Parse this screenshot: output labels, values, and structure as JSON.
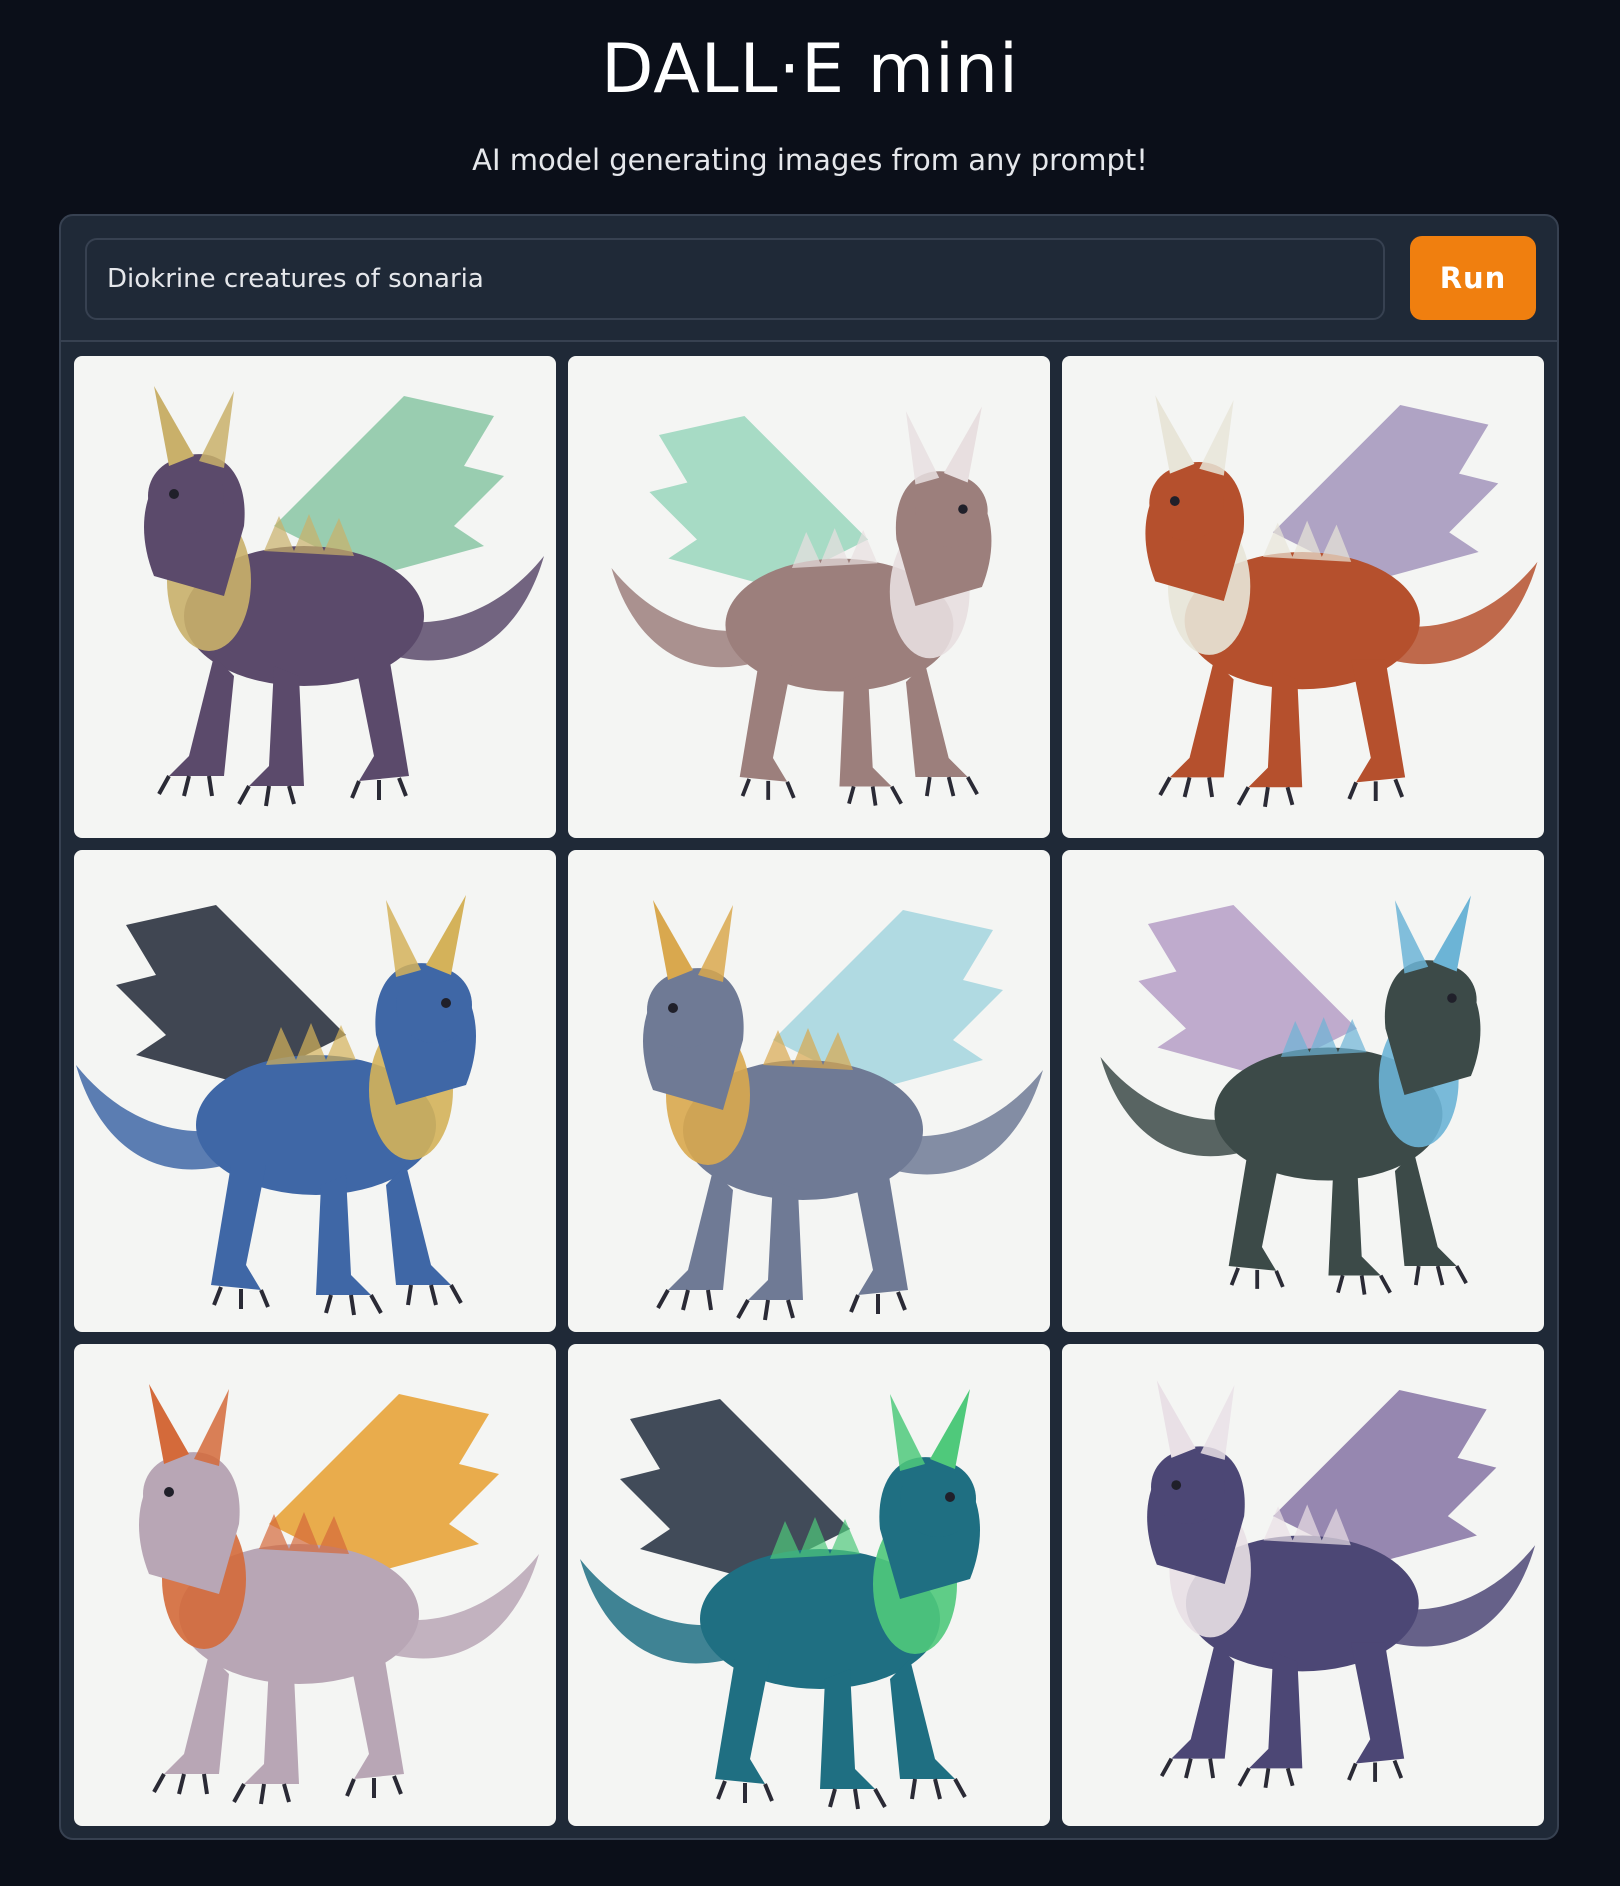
{
  "header": {
    "title": "DALL·E mini",
    "subtitle": "AI model generating images from any prompt!"
  },
  "prompt": {
    "value": "Diokrine creatures of sonaria"
  },
  "run_button": {
    "label": "Run"
  },
  "colors": {
    "background": "#0b0f19",
    "panel": "#1f2937",
    "border": "#374151",
    "accent": "#f07f0f",
    "image_background": "#f4f5f3"
  },
  "gallery": {
    "images": [
      {
        "subject": "purple-winged-creature",
        "body": "#5b4a6b",
        "accent": "#c9b06a",
        "wing": "#8fc9a8"
      },
      {
        "subject": "furred-mint-winged-creature",
        "body": "#9c7f7c",
        "accent": "#e8dfe0",
        "wing": "#9fd8c0"
      },
      {
        "subject": "red-horned-creature",
        "body": "#b5502d",
        "accent": "#e8e5d8",
        "wing": "#a79abf"
      },
      {
        "subject": "blue-spiked-creature",
        "body": "#3f67a6",
        "accent": "#d4b25a",
        "wing": "#2c3340"
      },
      {
        "subject": "grey-spiked-creature",
        "body": "#6f7a95",
        "accent": "#d9a84e",
        "wing": "#a9d7e0"
      },
      {
        "subject": "dark-winged-creature",
        "body": "#3c4a48",
        "accent": "#6cb4d6",
        "wing": "#b9a3c9"
      },
      {
        "subject": "orange-winged-creature",
        "body": "#b8a6b5",
        "accent": "#d46a3a",
        "wing": "#e8a43a"
      },
      {
        "subject": "teal-furred-creature",
        "body": "#1f6f82",
        "accent": "#4fc97b",
        "wing": "#2d3848"
      },
      {
        "subject": "purple-bat-winged-creature",
        "body": "#4c4775",
        "accent": "#e9e0e6",
        "wing": "#8c7ba8"
      }
    ]
  }
}
